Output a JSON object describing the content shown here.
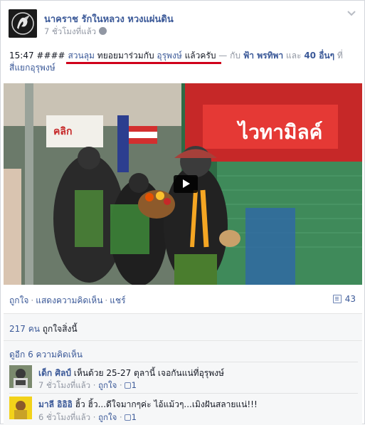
{
  "post": {
    "page_name": "นาคราช รักในหลวง หวงแผ่นดิน",
    "time": "7 ชั่วโมงที่แล้ว",
    "text": {
      "time_prefix": "15:47 #### ",
      "link1": "สวนลุม",
      "middle": " ทยอยมาร่วมกับ ",
      "link2": "อุรุพงษ์",
      "end_text": " แล้วครับ",
      "with_text": " — กับ ",
      "friend1": "ฟ้า พรทิพา",
      "and_text": " และ ",
      "others": "40 อื่นๆ",
      "at_text": " ที่",
      "location": "สี่แยกอุรุพงษ์"
    }
  },
  "actions": {
    "like": "ถูกใจ",
    "comment": "แสดงความคิดเห็น",
    "share": "แชร์",
    "separator": "·",
    "comment_count": "43"
  },
  "likes": {
    "count_link": "217 คน",
    "suffix": " ถูกใจสิ่งนี้"
  },
  "more_comments": "ดูอีก 6 ความคิดเห็น",
  "comments": [
    {
      "author": "เด็ก ศิลป์",
      "text": " เห็นด้วย 25-27 ตุลานี้ เจอกันแน่ที่อุรุพงษ์",
      "time": "7 ชั่วโมงที่แล้ว",
      "like": "ถูกใจ",
      "like_count": "1"
    },
    {
      "author": "มาลี อิอิอิ",
      "text": " ฮิ้ว ฮิ้ว...ดีใจมากๆค่ะ ไอ้แม้วๆ...เมิงฝันสลายแน่!!!",
      "time": "6 ชั่วโมงที่แล้ว",
      "like": "ถูกใจ",
      "like_count": "1"
    }
  ],
  "video_signs": {
    "sign_left": "คลิก",
    "sign_right": "ไวทามิลค์"
  },
  "colors": {
    "link": "#3b5998",
    "muted": "#9197a3",
    "highlight_underline": "#d0021b",
    "panel": "#f6f7f8"
  },
  "icons": [
    "page-avatar",
    "globe-icon",
    "chevron-down-icon",
    "play-icon",
    "comment-count-icon",
    "thumbs-up-icon"
  ]
}
